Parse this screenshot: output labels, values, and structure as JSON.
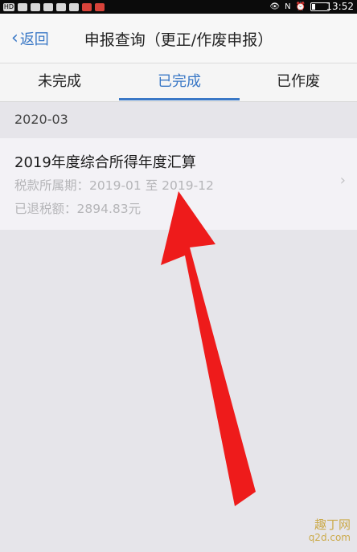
{
  "status_bar": {
    "time": "13:52",
    "network_label": "HD"
  },
  "nav": {
    "back_label": "返回",
    "title": "申报查询（更正/作废申报）"
  },
  "tabs": [
    {
      "label": "未完成"
    },
    {
      "label": "已完成"
    },
    {
      "label": "已作废"
    }
  ],
  "section": {
    "date": "2020-03"
  },
  "record": {
    "title": "2019年度综合所得年度汇算",
    "period": "税款所属期：2019-01 至 2019-12",
    "refund": "已退税额：2894.83元"
  },
  "watermark": {
    "text": "趣丁网",
    "site": "q2d.com"
  },
  "colors": {
    "accent": "#3a78c6",
    "arrow": "#ee1b1b"
  }
}
